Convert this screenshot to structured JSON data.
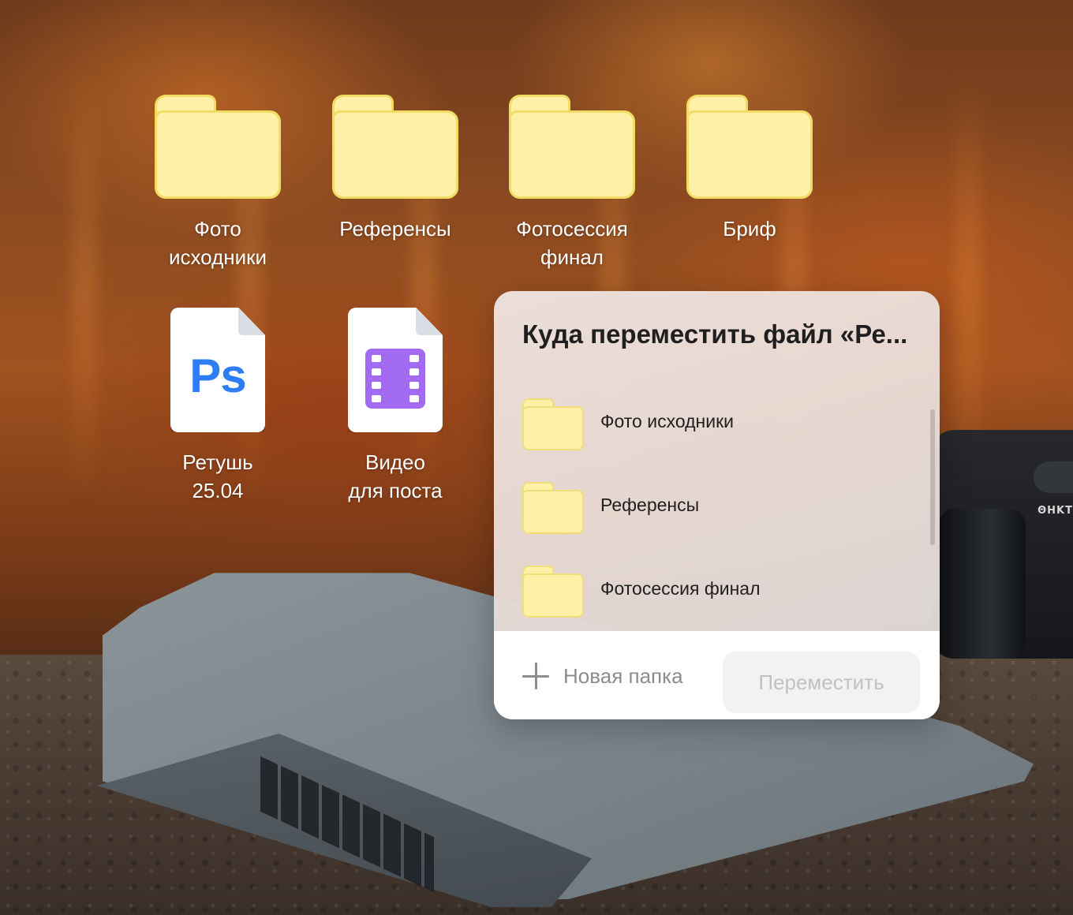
{
  "desktop": {
    "folders": [
      {
        "label": "Фото\nисходники"
      },
      {
        "label": "Референсы"
      },
      {
        "label": "Фотосессия\nфинал"
      },
      {
        "label": "Бриф"
      }
    ],
    "files": [
      {
        "label": "Ретушь\n25.04",
        "badge": "Ps",
        "icon": "photoshop-file-icon"
      },
      {
        "label": "Видео\nдля поста",
        "icon": "video-file-icon"
      }
    ]
  },
  "dialog": {
    "title": "Куда переместить файл «Ре...",
    "items": [
      {
        "label": "Фото исходники"
      },
      {
        "label": "Референсы"
      },
      {
        "label": "Фотосессия финал"
      }
    ],
    "new_folder_label": "Новая папка",
    "move_label": "Переместить"
  },
  "colors": {
    "folder_fill": "#fff0a8",
    "folder_border": "#f3dc64",
    "ps_blue": "#2c7df6",
    "video_purple": "#a36bf2",
    "disabled_text": "#c1c1c1"
  },
  "camera": {
    "brand": "ΘHKT"
  }
}
